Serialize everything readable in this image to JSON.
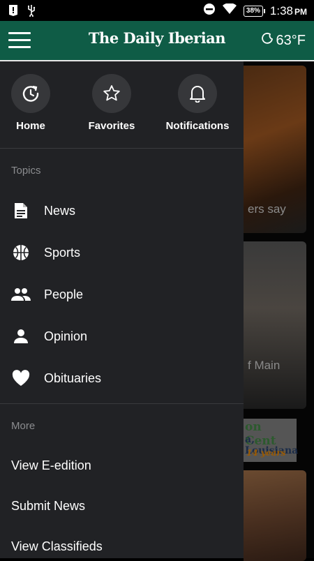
{
  "status": {
    "time": "1:38",
    "ampm": "PM",
    "battery": "38%"
  },
  "appbar": {
    "title": "The Daily Iberian",
    "weather": "63°F"
  },
  "drawer": {
    "quick": [
      {
        "label": "Home",
        "icon": "home-refresh-icon"
      },
      {
        "label": "Favorites",
        "icon": "star-icon"
      },
      {
        "label": "Notifications",
        "icon": "bell-icon"
      }
    ],
    "topics_header": "Topics",
    "topics": [
      {
        "label": "News",
        "icon": "document-icon"
      },
      {
        "label": "Sports",
        "icon": "basketball-icon"
      },
      {
        "label": "People",
        "icon": "people-icon"
      },
      {
        "label": "Opinion",
        "icon": "person-icon"
      },
      {
        "label": "Obituaries",
        "icon": "heart-icon"
      }
    ],
    "more_header": "More",
    "more": [
      "View E-edition",
      "Submit News",
      "View Classifieds"
    ]
  },
  "content": {
    "card1_caption": "ers say",
    "card2_caption": "f Main",
    "ad_line1": "on Cent",
    "ad_line2": "a, Louisiana",
    "ad_line3": "14 years"
  }
}
